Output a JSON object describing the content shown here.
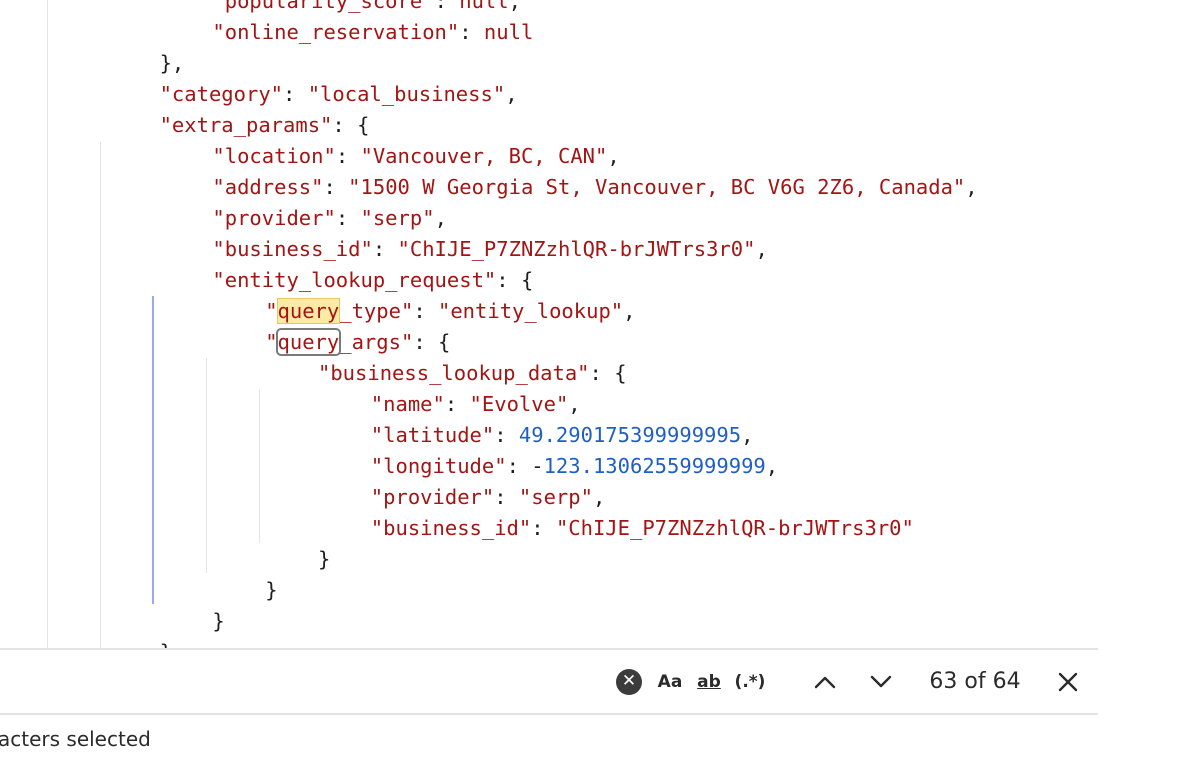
{
  "editor": {
    "lines": [
      {
        "indent": "      ",
        "parts": [
          {
            "t": "\"popularity_score\"",
            "c": "key"
          },
          {
            "t": ": ",
            "c": "p"
          },
          {
            "t": "null",
            "c": "kw"
          },
          {
            "t": ",",
            "c": "p"
          }
        ]
      },
      {
        "indent": "      ",
        "parts": [
          {
            "t": "\"online_reservation\"",
            "c": "key"
          },
          {
            "t": ": ",
            "c": "p"
          },
          {
            "t": "null",
            "c": "kw"
          }
        ]
      },
      {
        "indent": "    ",
        "parts": [
          {
            "t": "},",
            "c": "p"
          }
        ]
      },
      {
        "indent": "    ",
        "parts": [
          {
            "t": "\"category\"",
            "c": "key"
          },
          {
            "t": ": ",
            "c": "p"
          },
          {
            "t": "\"local_business\"",
            "c": "str"
          },
          {
            "t": ",",
            "c": "p"
          }
        ]
      },
      {
        "indent": "    ",
        "parts": [
          {
            "t": "\"extra_params\"",
            "c": "key"
          },
          {
            "t": ": {",
            "c": "p"
          }
        ]
      },
      {
        "indent": "      ",
        "parts": [
          {
            "t": "\"location\"",
            "c": "key"
          },
          {
            "t": ": ",
            "c": "p"
          },
          {
            "t": "\"Vancouver, BC, CAN\"",
            "c": "str"
          },
          {
            "t": ",",
            "c": "p"
          }
        ]
      },
      {
        "indent": "      ",
        "parts": [
          {
            "t": "\"address\"",
            "c": "key"
          },
          {
            "t": ": ",
            "c": "p"
          },
          {
            "t": "\"1500 W Georgia St, Vancouver, BC V6G 2Z6, Canada\"",
            "c": "str"
          },
          {
            "t": ",",
            "c": "p"
          }
        ]
      },
      {
        "indent": "      ",
        "parts": [
          {
            "t": "\"provider\"",
            "c": "key"
          },
          {
            "t": ": ",
            "c": "p"
          },
          {
            "t": "\"serp\"",
            "c": "str"
          },
          {
            "t": ",",
            "c": "p"
          }
        ]
      },
      {
        "indent": "      ",
        "parts": [
          {
            "t": "\"business_id\"",
            "c": "key"
          },
          {
            "t": ": ",
            "c": "p"
          },
          {
            "t": "\"ChIJE_P7ZNZzhlQR-brJWTrs3r0\"",
            "c": "str"
          },
          {
            "t": ",",
            "c": "p"
          }
        ]
      },
      {
        "indent": "      ",
        "parts": [
          {
            "t": "\"entity_lookup_request\"",
            "c": "key"
          },
          {
            "t": ": {",
            "c": "p"
          }
        ]
      },
      {
        "indent": "        ",
        "parts": [
          {
            "t": "\"",
            "c": "key"
          },
          {
            "t": "query",
            "c": "key",
            "hl": "match"
          },
          {
            "t": "_type\"",
            "c": "key"
          },
          {
            "t": ": ",
            "c": "p"
          },
          {
            "t": "\"entity_lookup\"",
            "c": "str"
          },
          {
            "t": ",",
            "c": "p"
          }
        ]
      },
      {
        "indent": "        ",
        "parts": [
          {
            "t": "\"",
            "c": "key"
          },
          {
            "t": "query",
            "c": "key",
            "hl": "current"
          },
          {
            "t": "_args\"",
            "c": "key"
          },
          {
            "t": ": {",
            "c": "p"
          }
        ]
      },
      {
        "indent": "          ",
        "parts": [
          {
            "t": "\"business_lookup_data\"",
            "c": "key"
          },
          {
            "t": ": {",
            "c": "p"
          }
        ]
      },
      {
        "indent": "            ",
        "parts": [
          {
            "t": "\"name\"",
            "c": "key"
          },
          {
            "t": ": ",
            "c": "p"
          },
          {
            "t": "\"Evolve\"",
            "c": "str"
          },
          {
            "t": ",",
            "c": "p"
          }
        ]
      },
      {
        "indent": "            ",
        "parts": [
          {
            "t": "\"latitude\"",
            "c": "key"
          },
          {
            "t": ": ",
            "c": "p"
          },
          {
            "t": "49.290175399999995",
            "c": "num"
          },
          {
            "t": ",",
            "c": "p"
          }
        ]
      },
      {
        "indent": "            ",
        "parts": [
          {
            "t": "\"longitude\"",
            "c": "key"
          },
          {
            "t": ": -",
            "c": "p"
          },
          {
            "t": "123.13062559999999",
            "c": "num"
          },
          {
            "t": ",",
            "c": "p"
          }
        ]
      },
      {
        "indent": "            ",
        "parts": [
          {
            "t": "\"provider\"",
            "c": "key"
          },
          {
            "t": ": ",
            "c": "p"
          },
          {
            "t": "\"serp\"",
            "c": "str"
          },
          {
            "t": ",",
            "c": "p"
          }
        ]
      },
      {
        "indent": "            ",
        "parts": [
          {
            "t": "\"business_id\"",
            "c": "key"
          },
          {
            "t": ": ",
            "c": "p"
          },
          {
            "t": "\"ChIJE_P7ZNZzhlQR-brJWTrs3r0\"",
            "c": "str"
          }
        ]
      },
      {
        "indent": "          ",
        "parts": [
          {
            "t": "}",
            "c": "p"
          }
        ]
      },
      {
        "indent": "        ",
        "parts": [
          {
            "t": "}",
            "c": "p"
          }
        ]
      },
      {
        "indent": "      ",
        "parts": [
          {
            "t": "}",
            "c": "p"
          }
        ]
      },
      {
        "indent": "    ",
        "parts": [
          {
            "t": "}",
            "c": "p"
          }
        ]
      }
    ]
  },
  "find_bar": {
    "clear_symbol": "✕",
    "match_case_label": "Aa",
    "whole_word_label": "ab",
    "regex_label": "(.*)",
    "counter": "63 of 64"
  },
  "status_bar": {
    "text": "acters selected"
  }
}
